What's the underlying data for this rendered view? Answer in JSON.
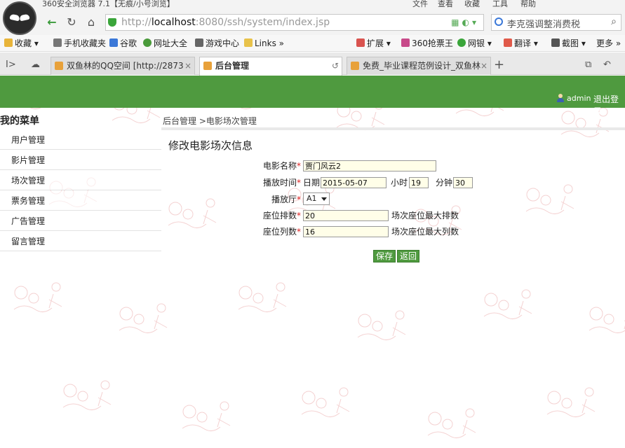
{
  "browser": {
    "title": "360安全浏览器 7.1【无痕/小号浏览】",
    "menu": [
      "文件",
      "查看",
      "收藏",
      "工具",
      "帮助"
    ],
    "url_scheme": "http://",
    "url_host": "localhost",
    "url_path": ":8080/ssh/system/index.jsp",
    "search_text": "李克强调整消费税",
    "bookmarks": [
      "收藏",
      "手机收藏夹",
      "谷歌",
      "网址大全",
      "游戏中心",
      "Links",
      "扩展",
      "360抢票王",
      "网银",
      "翻译",
      "截图",
      "更多"
    ],
    "tabs": [
      {
        "label": "双鱼林的QQ空间 [http://2873"
      },
      {
        "label": "后台管理"
      },
      {
        "label": "免费_毕业课程范例设计_双鱼林"
      }
    ]
  },
  "header": {
    "user": "admin",
    "logout": "退出登录"
  },
  "sidebar": {
    "title": "我的菜单",
    "items": [
      "用户管理",
      "影片管理",
      "场次管理",
      "票务管理",
      "广告管理",
      "留言管理"
    ]
  },
  "breadcrumb": "后台管理 >电影场次管理",
  "form": {
    "heading": "修改电影场次信息",
    "movie_name_label": "电影名称",
    "movie_name": "贾门风云2",
    "time_label": "播放时间",
    "date_label": "日期",
    "date": "2015-05-07",
    "hour_label": "小时",
    "hour": "19",
    "minute_label": "分钟",
    "minute": "30",
    "hall_label": "播放厅",
    "hall": "A1",
    "rows_label": "座位排数",
    "rows": "20",
    "rows_hint": "场次座位最大排数",
    "cols_label": "座位列数",
    "cols": "16",
    "cols_hint": "场次座位最大列数",
    "required_mark": "*",
    "save": "保存",
    "back": "返回"
  },
  "colors": {
    "header_green": "#4f9a3f",
    "required_red": "#d22222"
  }
}
